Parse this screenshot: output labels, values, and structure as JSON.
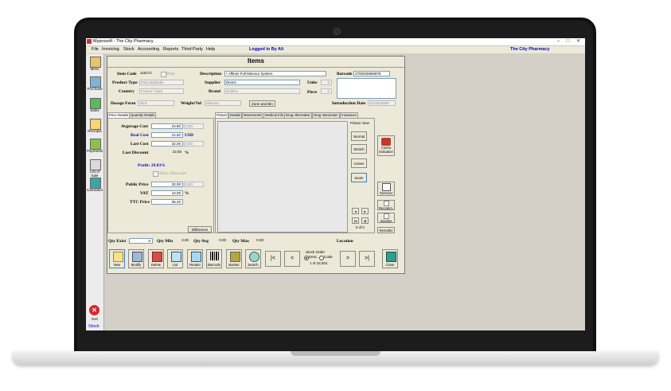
{
  "window": {
    "title": "Myprosoft - The City Pharmacy",
    "logged_in": "Logged in By Ali",
    "company": "The City Pharmacy"
  },
  "menu": [
    "File",
    "Invoicing",
    "Stock",
    "Accounting",
    "Reports",
    "Third Party",
    "Help"
  ],
  "sidebar": [
    {
      "label": "Items"
    },
    {
      "label": "Purchase"
    },
    {
      "label": "Sales"
    },
    {
      "label": "Receipts"
    },
    {
      "label": "Payments"
    },
    {
      "label": "List of Sale"
    },
    {
      "label": "Calculator"
    }
  ],
  "exit_label": "Exit",
  "status_text": "Stock",
  "form": {
    "title": "Items",
    "item_code_label": "Item Code",
    "item_code": "116172",
    "print_label": "Print",
    "description_label": "Description",
    "description": "* Affines Full Minceur System",
    "barcode_label": "Barcode",
    "barcode": "3700026990878",
    "product_type_label": "Product Type",
    "product_type": "Para Medicale",
    "supplier_label": "Supplier",
    "supplier": "Divers",
    "units_label": "Units",
    "units": "0",
    "country_label": "Country",
    "country": "France / Sure",
    "brand_label": "Brand",
    "brand": "Dolless",
    "piece_label": "Piece",
    "piece": "0",
    "dosage_form_label": "Dosage Form",
    "dosage_form": "Stick",
    "weight_label": "Weight/Vol",
    "weight": "Minceur",
    "zone_button": "Zone and Bin",
    "intro_date_label": "Introduction Date",
    "intro_date": "01/Jan/2020"
  },
  "left_tabs": [
    "Price Details",
    "Quantity Details"
  ],
  "price": {
    "avg_cost_label": "Avgerage Cost",
    "avg_cost": "24.80",
    "avg_currency": "USD",
    "real_cost_label": "Real Cost",
    "real_cost": "24.80",
    "real_currency": "USD",
    "last_cost_label": "Last Cost",
    "last_cost": "32.00",
    "last_currency": "USD",
    "last_discount_label": "Last Discount",
    "last_discount": "22.50",
    "percent": "%",
    "profit": "Profit: 29.03%",
    "allow_discount": "Allow Discount",
    "public_price_label": "Public Price",
    "public_price": "32.00",
    "public_currency": "USD",
    "vat_label": "VAT",
    "vat": "10.00",
    "vat_pct": "%",
    "ttc_label": "TTC Price",
    "ttc": "35.20",
    "difference_button": "Difference"
  },
  "right_tabs": [
    "Picture",
    "Details",
    "Movements",
    "Medical Info",
    "Drug Alternative",
    "Drug Interaction",
    "Insurance"
  ],
  "picture": {
    "view_label": "Picture View",
    "buttons": [
      "Normal",
      "Stretch",
      "Center",
      "Zoom"
    ],
    "counter": "0 of 0"
  },
  "side_buttons": {
    "contra": "Contra indication",
    "turnover": "Turnover",
    "recomm": "Recomm.",
    "inactive": "Inactive",
    "remarks": "Remarks"
  },
  "qty": {
    "exist_label": "Qty Exist",
    "exist": "0",
    "min_label": "Qty Min",
    "min": "2.00",
    "avg_label": "Qty Avg",
    "avg": "0.00",
    "max_label": "Qty Max",
    "max": "0.00",
    "location_label": "Location"
  },
  "toolbar": [
    "New",
    "Modify",
    "Delete",
    "List",
    "Reader",
    "Barcode",
    "Basket",
    "Search"
  ],
  "nav": {
    "first": "|<",
    "prev": "<",
    "next": ">",
    "last": ">|"
  },
  "stock_order": {
    "label": "Stock Order",
    "desc": "Desc.",
    "code": "Code",
    "record": "1 of 42,501"
  },
  "close_label": "Close",
  "colors": {
    "accent_blue": "#0000c8",
    "bg": "#d4d0c8"
  }
}
